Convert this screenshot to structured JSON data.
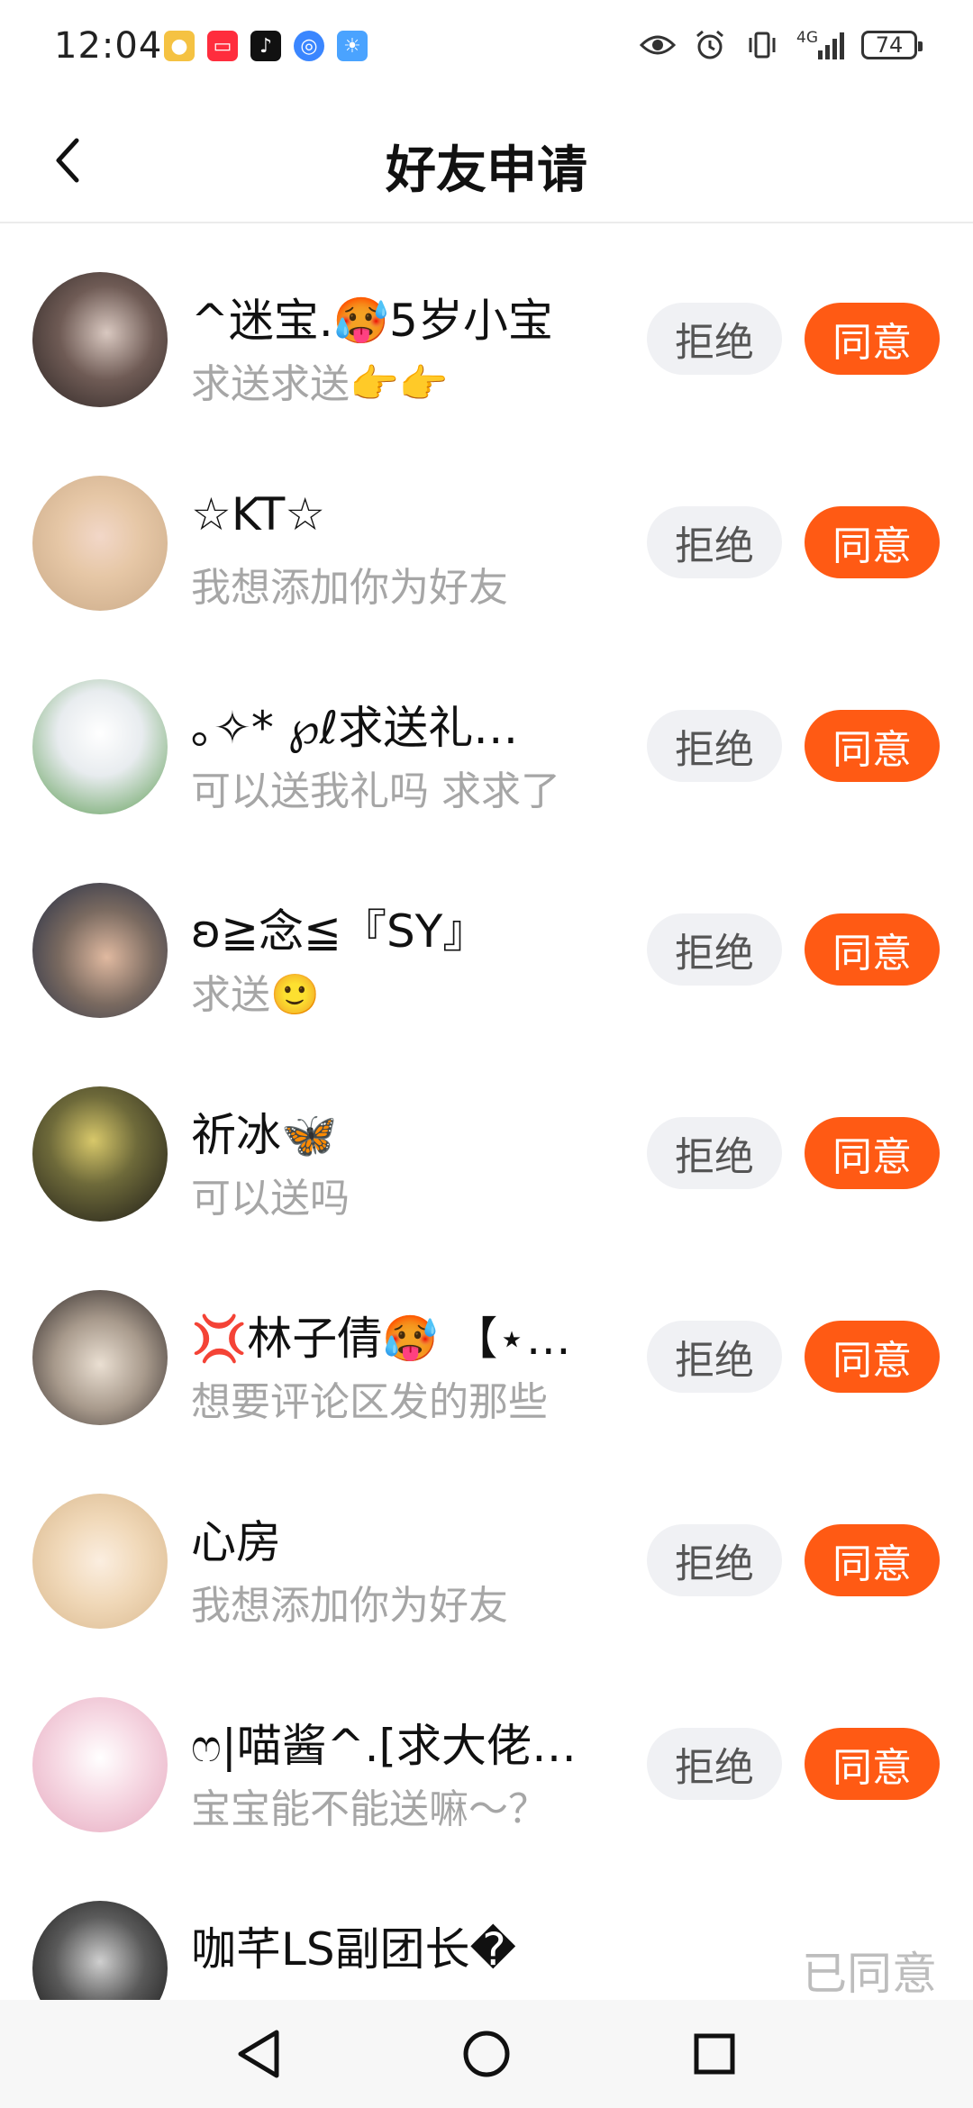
{
  "status_bar": {
    "time": "12:04",
    "network": "4G",
    "battery": "74",
    "icons": [
      "monkey-app-icon",
      "red-book-app-icon",
      "tiktok-app-icon",
      "browser-app-icon",
      "weather-app-icon",
      "eye-icon",
      "alarm-icon",
      "vibrate-icon",
      "signal-icon"
    ]
  },
  "header": {
    "title": "好友申请",
    "back_icon": "chevron-left-icon"
  },
  "buttons": {
    "reject": "拒绝",
    "accept": "同意",
    "accepted": "已同意"
  },
  "requests": [
    {
      "name": "^迷宝.🥵5岁小宝",
      "message": "求送求送👉👉",
      "status": "pending"
    },
    {
      "name": "☆KT☆",
      "message": "我想添加你为好友",
      "status": "pending"
    },
    {
      "name": "｡✧* ℘ℓ求送礼…",
      "message": "可以送我礼吗 求求了",
      "status": "pending"
    },
    {
      "name": "ʚ≧念≦『SY』",
      "message": "求送🙂",
      "status": "pending"
    },
    {
      "name": "祈冰🦋",
      "message": "可以送吗",
      "status": "pending"
    },
    {
      "name": "💢林子倩🥵 【⋆…",
      "message": "想要评论区发的那些",
      "status": "pending"
    },
    {
      "name": "心房",
      "message": "我想添加你为好友",
      "status": "pending"
    },
    {
      "name": "ෆ|喵酱^.[求大佬…",
      "message": "宝宝能不能送嘛～？",
      "status": "pending"
    },
    {
      "name": "咖芊LS副团长�",
      "message": "",
      "status": "accepted"
    }
  ],
  "nav": {
    "icons": [
      "back-triangle-icon",
      "home-circle-icon",
      "recents-square-icon"
    ]
  }
}
